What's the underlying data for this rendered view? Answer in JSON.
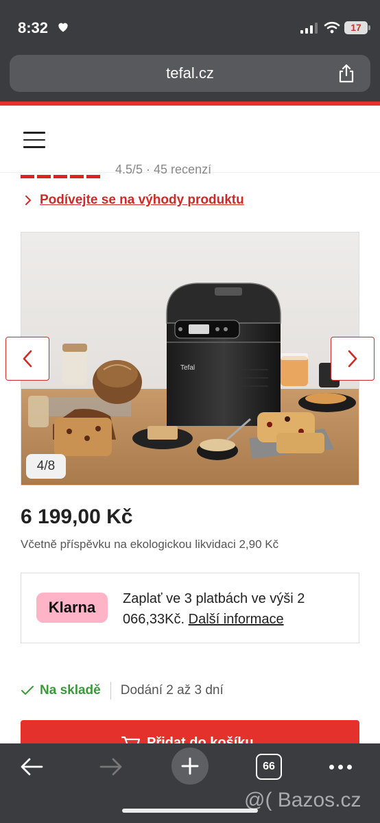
{
  "status_bar": {
    "time": "8:32",
    "battery": "17"
  },
  "browser": {
    "url": "tefal.cz",
    "tabs_count": "66"
  },
  "product": {
    "rating_text": "4.5/5 · 45 recenzí",
    "benefits_link": "Podívejte se na výhody produktu",
    "gallery": {
      "counter": "4/8",
      "brand_on_product": "Tefal"
    },
    "price": "6 199,00 Kč",
    "eco_note": "Včetně příspěvku na ekologickou likvidaci 2,90 Kč",
    "klarna": {
      "logo": "Klarna",
      "text": "Zaplať ve 3 platbách ve výši 2 066,33Kč.",
      "more_link": "Další informace",
      "badge_color": "#ffb3c7"
    },
    "stock": {
      "status": "Na skladě",
      "delivery": "Dodání 2 až 3 dní"
    },
    "cart_button": "Přidat do košíku"
  },
  "watermark": "@( Bazos.cz",
  "colors": {
    "accent": "#e4312b",
    "stock_green": "#3a9a3a",
    "chrome": "#3a3c3f"
  }
}
